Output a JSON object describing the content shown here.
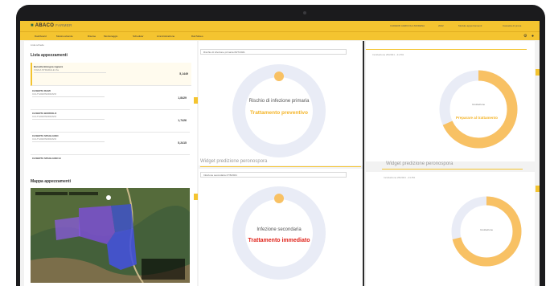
{
  "brand": {
    "logo": "ABACO",
    "logo_suffix": "FARMER"
  },
  "topbar_selectors": [
    "CADERZI AGRICOLA MODENA",
    "2022",
    "Modulo appezzamenti",
    "Cassetta di prova"
  ],
  "nav": [
    "Dashboard",
    "Mostra aziende",
    "Risorse",
    "Monitoraggio",
    "Scheduler",
    "Amministrazione",
    "Dati Meteo"
  ],
  "crumb": "Lista schede",
  "left": {
    "list_title": "Lista appezzamenti",
    "items": [
      {
        "name": "Barcella Bologna vignerà",
        "sub": "VIGNA STRADALE Via",
        "price": "5,1449"
      },
      {
        "name": "CASERTA RAMI",
        "sub": "CULTIVAR/INDIRIZZO",
        "price": "1,8429"
      },
      {
        "name": "CASERTA BORDOLO",
        "sub": "CULTIVAR/INDIRIZZO",
        "price": "1,7426"
      },
      {
        "name": "CASERTA SPAGLIANO",
        "sub": "CULTIVAR/INDIRIZZO",
        "price": "5,2415"
      },
      {
        "name": "CASERTA SPAGLIANO B",
        "sub": "CULTIVAR/INDIRIZZO",
        "price": ""
      }
    ],
    "map_title": "Mappa appezzamenti"
  },
  "middle": {
    "top_dropdown": "Rischio di infezione primaria 06/7/2021",
    "top_label": "Rischio di infezione primaria",
    "top_status": "Trattamento preventivo",
    "bottom_title": "Widget predizione peronospora",
    "bottom_dropdown": "Infezione secondaria 27/6/2021",
    "bottom_label": "Infezione secondaria",
    "bottom_status": "Trattamento immediato"
  },
  "right": {
    "top_dropdown": "Incubazione 26/2021 - 41-5%",
    "top_ring_label": "Incubazione",
    "top_ring_status": "Preparare al trattamento",
    "bottom_title": "Widget predizione peronospora",
    "bottom_dropdown": "Incubazione 26/2021 - 41-5%",
    "bottom_ring_label": "Incubazione"
  },
  "colors": {
    "accent": "#f4c430",
    "ring": "#f8c164",
    "ring_bg": "#e9ecf6",
    "alert": "#e0231a",
    "warn": "#f4b428"
  },
  "icons": [
    "camera-icon",
    "settings-icon",
    "user-icon",
    "chevron-down-icon"
  ]
}
